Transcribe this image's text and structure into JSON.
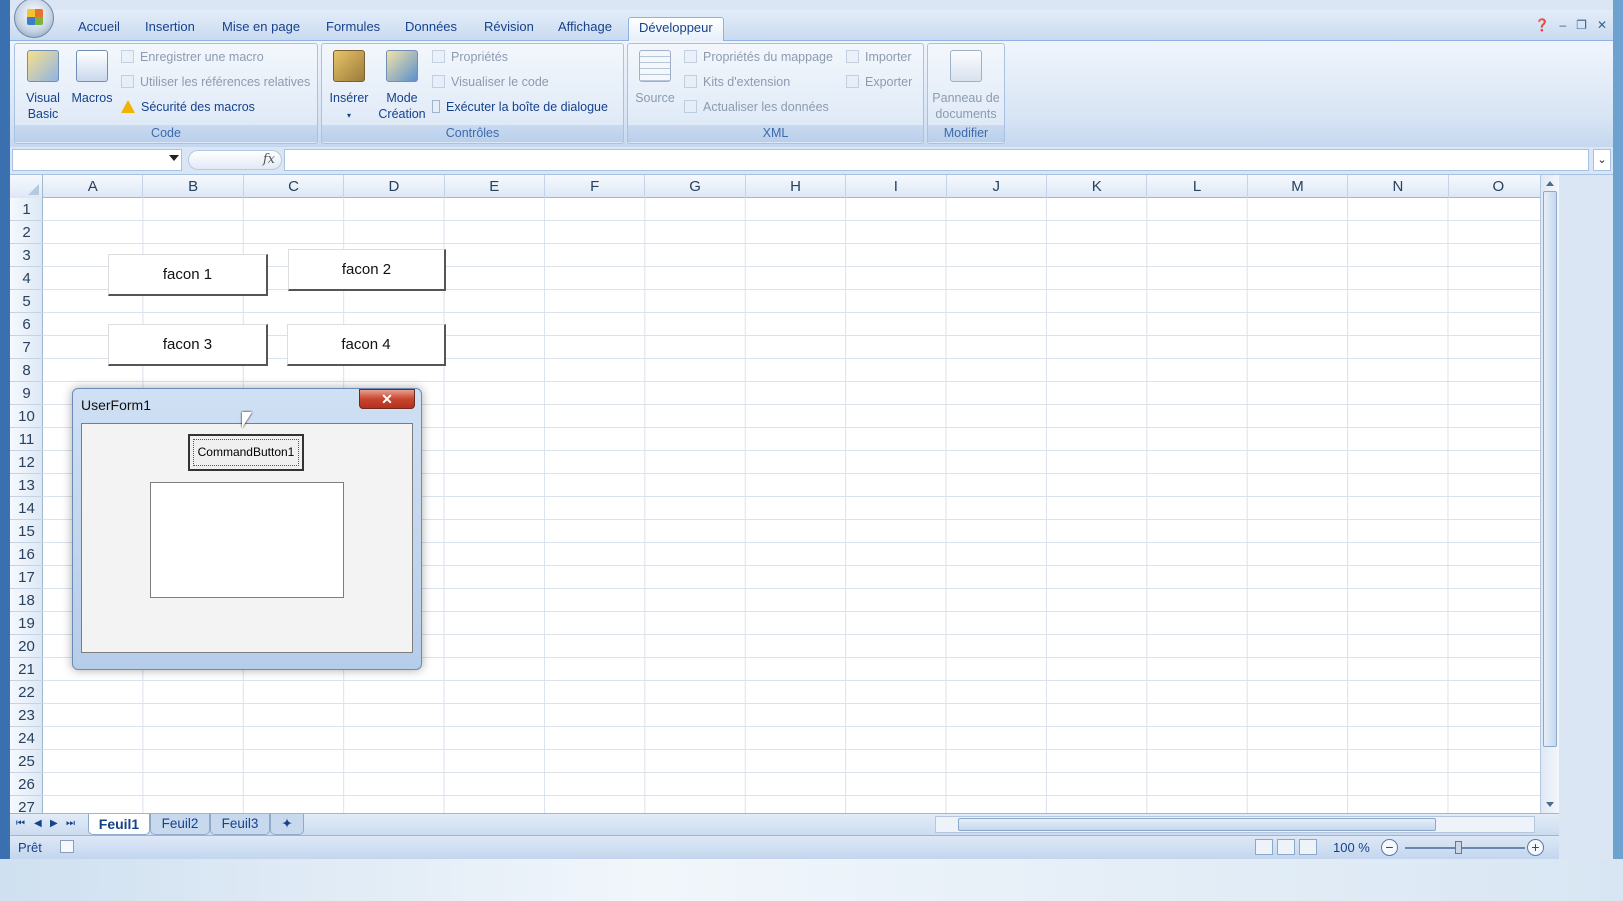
{
  "tabs": [
    {
      "label": "Accueil"
    },
    {
      "label": "Insertion"
    },
    {
      "label": "Mise en page"
    },
    {
      "label": "Formules"
    },
    {
      "label": "Données"
    },
    {
      "label": "Révision"
    },
    {
      "label": "Affichage"
    },
    {
      "label": "Développeur"
    }
  ],
  "ribbon": {
    "code": {
      "label": "Code",
      "visual_basic": "Visual Basic",
      "macros": "Macros",
      "record_macro": "Enregistrer une macro",
      "relative_refs": "Utiliser les références relatives",
      "macro_security": "Sécurité des macros"
    },
    "controls": {
      "label": "Contrôles",
      "insert": "Insérer",
      "design_mode_1": "Mode",
      "design_mode_2": "Création",
      "properties": "Propriétés",
      "view_code": "Visualiser le code",
      "run_dialog": "Exécuter la boîte de dialogue"
    },
    "xml": {
      "label": "XML",
      "source": "Source",
      "map_properties": "Propriétés du mappage",
      "expansion_packs": "Kits d'extension",
      "refresh_data": "Actualiser les données",
      "import": "Importer",
      "export": "Exporter"
    },
    "modify": {
      "label": "Modifier",
      "doc_panel_1": "Panneau de",
      "doc_panel_2": "documents"
    }
  },
  "formula_bar": {
    "fx": "fx"
  },
  "columns": [
    "A",
    "B",
    "C",
    "D",
    "E",
    "F",
    "G",
    "H",
    "I",
    "J",
    "K",
    "L",
    "M",
    "N",
    "O"
  ],
  "rows": [
    "1",
    "2",
    "3",
    "4",
    "5",
    "6",
    "7",
    "8",
    "9",
    "10",
    "11",
    "12",
    "13",
    "14",
    "15",
    "16",
    "17",
    "18",
    "19",
    "20",
    "21",
    "22",
    "23",
    "24",
    "25",
    "26",
    "27"
  ],
  "sheet_buttons": [
    "facon 1",
    "facon 2",
    "facon 3",
    "facon 4"
  ],
  "userform": {
    "title": "UserForm1",
    "close": "✕",
    "command_button": "CommandButton1"
  },
  "sheets": [
    {
      "label": "Feuil1"
    },
    {
      "label": "Feuil2"
    },
    {
      "label": "Feuil3"
    }
  ],
  "status": {
    "ready": "Prêt",
    "zoom": "100 %"
  }
}
